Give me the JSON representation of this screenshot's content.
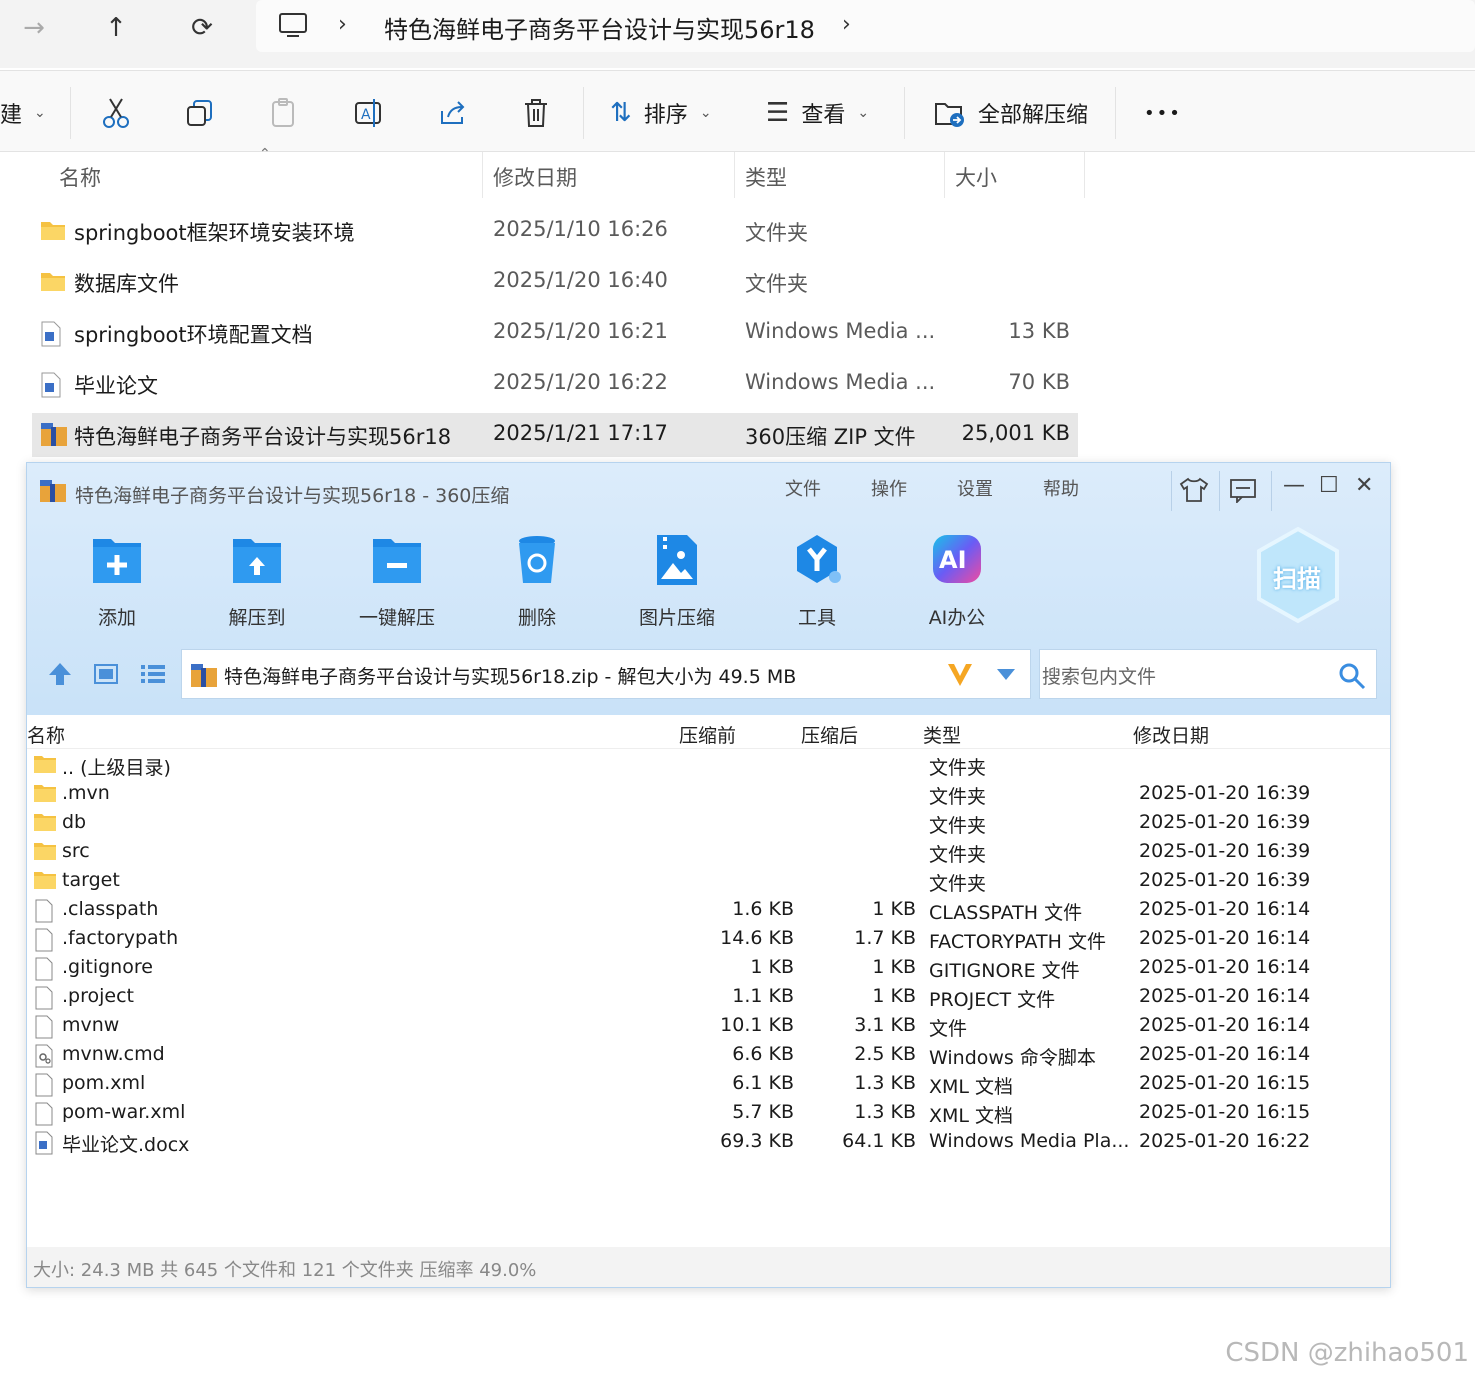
{
  "explorer": {
    "address": {
      "path_title": "特色海鲜电子商务平台设计与实现56r18"
    },
    "commandbar": {
      "new_partial": "建",
      "sort_label": "排序",
      "view_label": "查看",
      "extract_all_label": "全部解压缩",
      "more_label": "•••"
    },
    "columns": {
      "name": "名称",
      "modified": "修改日期",
      "type": "类型",
      "size": "大小"
    },
    "files": [
      {
        "name": "springboot框架环境安装环境",
        "modified": "2025/1/10 16:26",
        "type": "文件夹",
        "size": "",
        "icon": "folder-icon"
      },
      {
        "name": "数据库文件",
        "modified": "2025/1/20 16:40",
        "type": "文件夹",
        "size": "",
        "icon": "folder-icon"
      },
      {
        "name": "springboot环境配置文档",
        "modified": "2025/1/20 16:21",
        "type": "Windows Media ...",
        "size": "13 KB",
        "icon": "document-icon"
      },
      {
        "name": "毕业论文",
        "modified": "2025/1/20 16:22",
        "type": "Windows Media ...",
        "size": "70 KB",
        "icon": "document-icon"
      },
      {
        "name": "特色海鲜电子商务平台设计与实现56r18",
        "modified": "2025/1/21 17:17",
        "type": "360压缩 ZIP 文件",
        "size": "25,001 KB",
        "icon": "zip-icon"
      }
    ]
  },
  "zip": {
    "title": "特色海鲜电子商务平台设计与实现56r18 - 360压缩",
    "menus": [
      "文件",
      "操作",
      "设置",
      "帮助"
    ],
    "tools": [
      {
        "label": "添加",
        "icon": "add-folder-icon"
      },
      {
        "label": "解压到",
        "icon": "extract-to-icon"
      },
      {
        "label": "一键解压",
        "icon": "quick-extract-icon"
      },
      {
        "label": "删除",
        "icon": "delete-icon"
      },
      {
        "label": "图片压缩",
        "icon": "image-compress-icon"
      },
      {
        "label": "工具",
        "icon": "tools-icon"
      },
      {
        "label": "AI办公",
        "icon": "ai-office-icon"
      }
    ],
    "scan_label": "扫描",
    "ai_badge": "AI",
    "path_text": "特色海鲜电子商务平台设计与实现56r18.zip - 解包大小为 49.5 MB",
    "search_placeholder": "搜索包内文件",
    "columns": {
      "name": "名称",
      "before": "压缩前",
      "after": "压缩后",
      "type": "类型",
      "modified": "修改日期"
    },
    "entries": [
      {
        "name": ".. (上级目录)",
        "before": "",
        "after": "",
        "type": "文件夹",
        "modified": "",
        "icon": "folder-icon"
      },
      {
        "name": ".mvn",
        "before": "",
        "after": "",
        "type": "文件夹",
        "modified": "2025-01-20 16:39",
        "icon": "folder-icon"
      },
      {
        "name": "db",
        "before": "",
        "after": "",
        "type": "文件夹",
        "modified": "2025-01-20 16:39",
        "icon": "folder-icon"
      },
      {
        "name": "src",
        "before": "",
        "after": "",
        "type": "文件夹",
        "modified": "2025-01-20 16:39",
        "icon": "folder-icon"
      },
      {
        "name": "target",
        "before": "",
        "after": "",
        "type": "文件夹",
        "modified": "2025-01-20 16:39",
        "icon": "folder-icon"
      },
      {
        "name": ".classpath",
        "before": "1.6 KB",
        "after": "1 KB",
        "type": "CLASSPATH 文件",
        "modified": "2025-01-20 16:14",
        "icon": "file-icon"
      },
      {
        "name": ".factorypath",
        "before": "14.6 KB",
        "after": "1.7 KB",
        "type": "FACTORYPATH 文件",
        "modified": "2025-01-20 16:14",
        "icon": "file-icon"
      },
      {
        "name": ".gitignore",
        "before": "1 KB",
        "after": "1 KB",
        "type": "GITIGNORE 文件",
        "modified": "2025-01-20 16:14",
        "icon": "file-icon"
      },
      {
        "name": ".project",
        "before": "1.1 KB",
        "after": "1 KB",
        "type": "PROJECT 文件",
        "modified": "2025-01-20 16:14",
        "icon": "file-icon"
      },
      {
        "name": "mvnw",
        "before": "10.1 KB",
        "after": "3.1 KB",
        "type": "文件",
        "modified": "2025-01-20 16:14",
        "icon": "file-icon"
      },
      {
        "name": "mvnw.cmd",
        "before": "6.6 KB",
        "after": "2.5 KB",
        "type": "Windows 命令脚本",
        "modified": "2025-01-20 16:14",
        "icon": "script-icon"
      },
      {
        "name": "pom.xml",
        "before": "6.1 KB",
        "after": "1.3 KB",
        "type": "XML 文档",
        "modified": "2025-01-20 16:15",
        "icon": "file-icon"
      },
      {
        "name": "pom-war.xml",
        "before": "5.7 KB",
        "after": "1.3 KB",
        "type": "XML 文档",
        "modified": "2025-01-20 16:15",
        "icon": "file-icon"
      },
      {
        "name": "毕业论文.docx",
        "before": "69.3 KB",
        "after": "64.1 KB",
        "type": "Windows Media Pla...",
        "modified": "2025-01-20 16:22",
        "icon": "document-icon"
      }
    ],
    "status": "大小: 24.3 MB 共 645 个文件和 121 个文件夹 压缩率 49.0%"
  },
  "watermark": "CSDN @zhihao501",
  "colors": {
    "accent": "#1e88e5",
    "zip_header_bg": "#d3e7f9",
    "selected_row": "#e7e7e7",
    "folder": "#f5c242"
  }
}
